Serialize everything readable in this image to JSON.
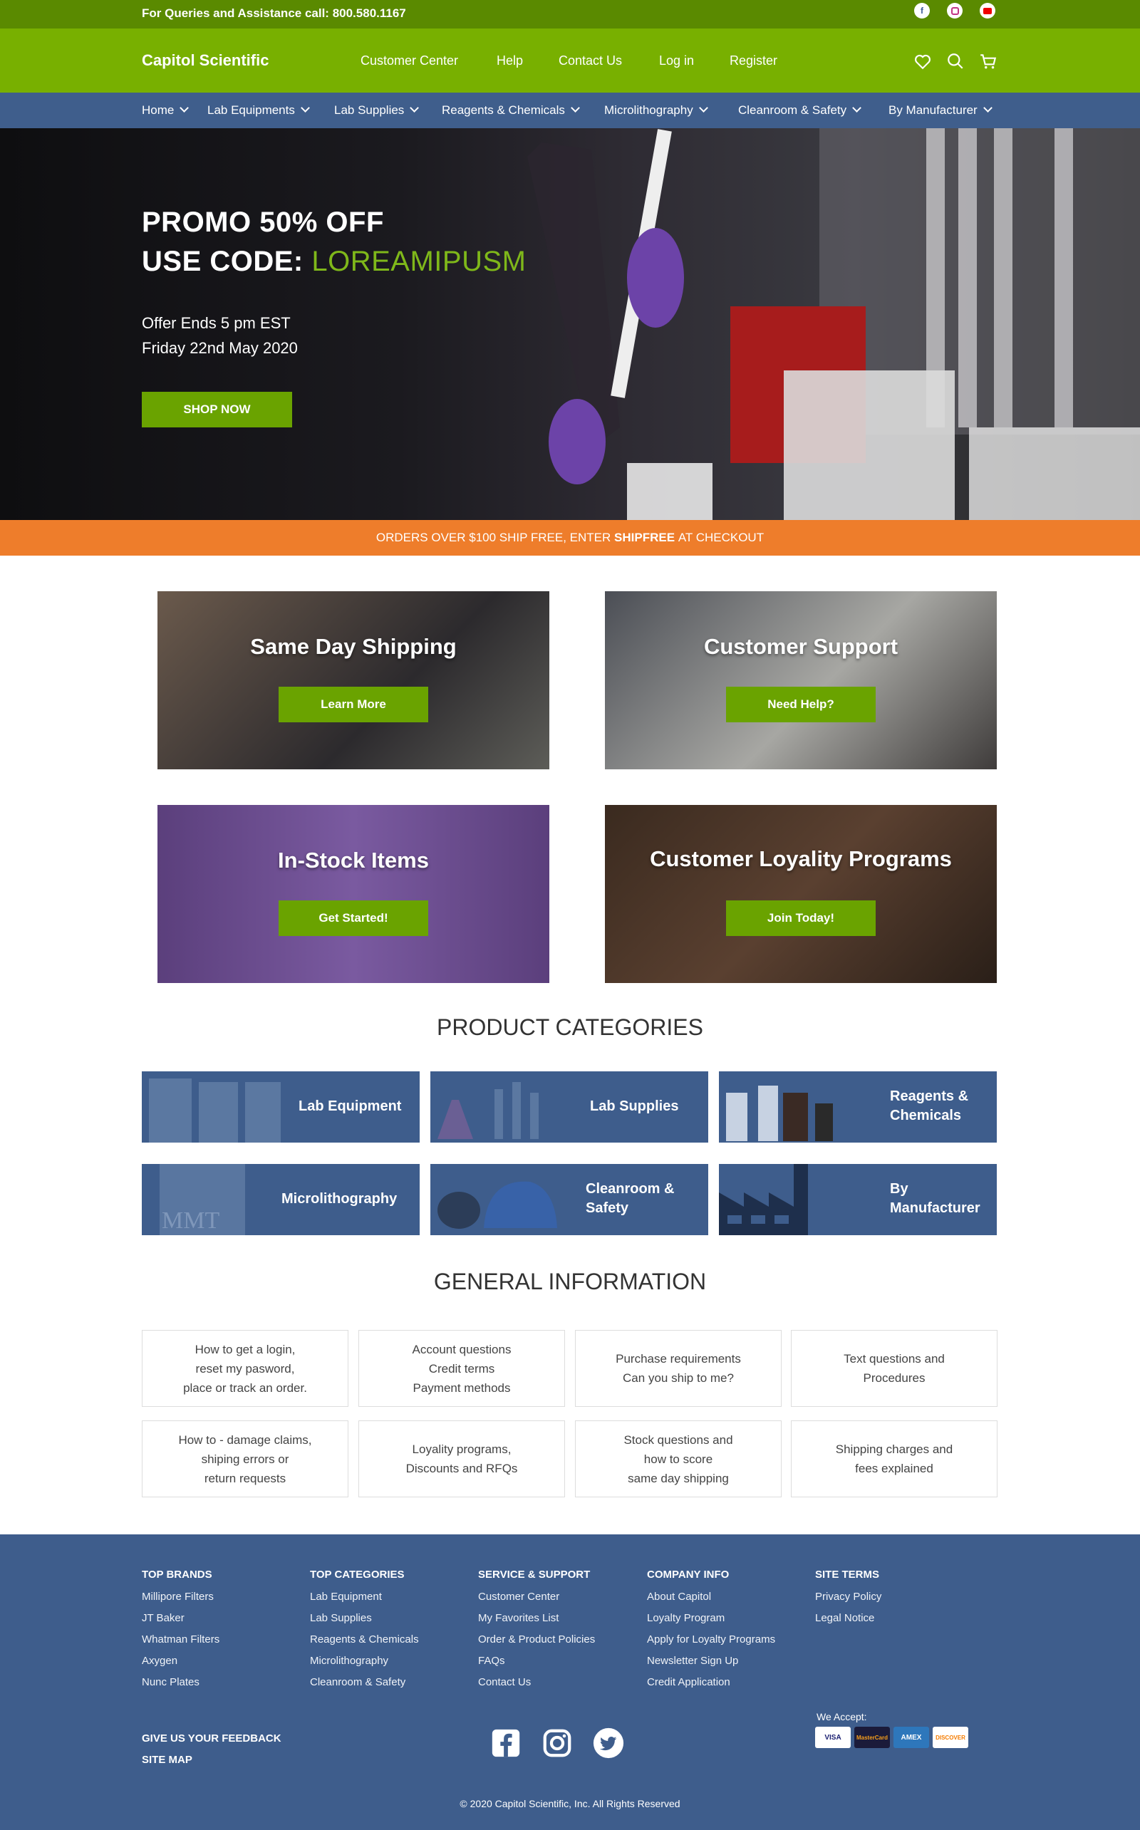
{
  "topbar": {
    "queries_text": "For Queries and Assistance call: 800.580.1167",
    "social_icons": [
      "facebook-icon",
      "instagram-icon",
      "youtube-icon"
    ]
  },
  "header": {
    "logo": "Capitol Scientific",
    "nav": [
      "Customer Center",
      "Help",
      "Contact Us",
      "Log in",
      "Register"
    ],
    "icons": [
      "heart-icon",
      "search-icon",
      "cart-icon"
    ]
  },
  "mainnav": {
    "items": [
      "Home",
      "Lab Equipments",
      "Lab Supplies",
      "Reagents & Chemicals",
      "Microlithography",
      "Cleanroom & Safety",
      "By Manufacturer"
    ]
  },
  "hero": {
    "line1": "PROMO 50% OFF",
    "line2_prefix": "USE CODE: ",
    "code": "LOREAMIPUSM",
    "offer_line1": "Offer Ends 5 pm EST",
    "offer_line2": "Friday 22nd May 2020",
    "button": "SHOP NOW"
  },
  "promo": {
    "prefix": "ORDERS OVER $100 SHIP FREE, ENTER ",
    "code": "SHIPFREE",
    "suffix": " AT CHECKOUT"
  },
  "features": [
    {
      "title": "Same Day Shipping",
      "button": "Learn More"
    },
    {
      "title": "Customer Support",
      "button": "Need Help?"
    },
    {
      "title": "In-Stock Items",
      "button": "Get Started!"
    },
    {
      "title": "Customer Loyality Programs",
      "button": "Join Today!"
    }
  ],
  "product_categories": {
    "title": "PRODUCT CATEGORIES",
    "items": [
      {
        "line1": "Lab Equipment",
        "line2": ""
      },
      {
        "line1": "Lab Supplies",
        "line2": ""
      },
      {
        "line1": "Reagents &",
        "line2": "Chemicals"
      },
      {
        "line1": "Microlithography",
        "line2": ""
      },
      {
        "line1": "Cleanroom &",
        "line2": "Safety"
      },
      {
        "line1": "By",
        "line2": "Manufacturer"
      }
    ],
    "mmt_text": "MMT"
  },
  "general_info": {
    "title": "GENERAL INFORMATION",
    "items": [
      [
        "How to get a login,",
        "reset my pasword,",
        "place or track an order."
      ],
      [
        "Account questions",
        "Credit terms",
        "Payment methods"
      ],
      [
        "Purchase requirements",
        "Can you ship to me?",
        ""
      ],
      [
        "Text questions and",
        "Procedures",
        ""
      ],
      [
        "How to - damage claims,",
        "shiping errors or",
        "return requests"
      ],
      [
        "Loyality programs,",
        "Discounts and RFQs",
        ""
      ],
      [
        "Stock questions and",
        "how to score",
        "same day shipping"
      ],
      [
        "Shipping charges and",
        "fees explained",
        ""
      ]
    ]
  },
  "footer": {
    "columns": [
      {
        "title": "TOP BRANDS",
        "items": [
          "Millipore Filters",
          "JT Baker",
          "Whatman Filters",
          "Axygen",
          "Nunc Plates"
        ]
      },
      {
        "title": "TOP CATEGORIES",
        "items": [
          "Lab Equipment",
          "Lab Supplies",
          "Reagents & Chemicals",
          "Microlithography",
          "Cleanroom & Safety"
        ]
      },
      {
        "title": "SERVICE & SUPPORT",
        "items": [
          "Customer Center",
          "My Favorites List",
          "Order & Product Policies",
          "FAQs",
          "Contact Us"
        ]
      },
      {
        "title": "COMPANY INFO",
        "items": [
          "About Capitol",
          "Loyalty Program",
          "Apply for Loyalty Programs",
          "Newsletter Sign Up",
          "Credit Application"
        ]
      },
      {
        "title": "SITE TERMS",
        "items": [
          "Privacy Policy",
          "Legal Notice"
        ]
      }
    ],
    "feedback": "GIVE US YOUR FEEDBACK",
    "sitemap": "SITE MAP",
    "we_accept": "We Accept:",
    "cards": [
      "VISA",
      "MasterCard",
      "AMEX",
      "DISCOVER"
    ],
    "copyright": "© 2020 Capitol Scientific, Inc. All Rights Reserved"
  }
}
